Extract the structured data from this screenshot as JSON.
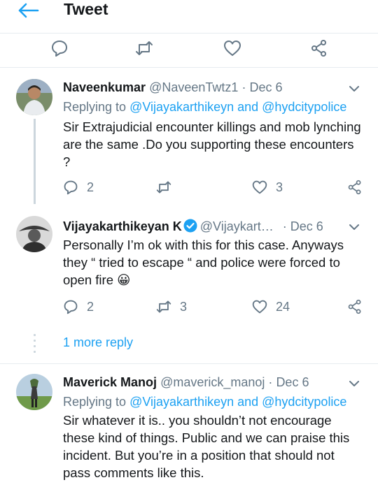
{
  "header": {
    "title": "Tweet"
  },
  "colors": {
    "accent": "#1da1f2",
    "muted": "#657786",
    "text": "#14171a",
    "border": "#e6ecf0"
  },
  "top_actions": [
    "reply-icon",
    "retweet-icon",
    "like-icon",
    "share-icon"
  ],
  "tweets": [
    {
      "name": "Naveenkumar",
      "handle": "@NaveenTwtz1",
      "dot": "·",
      "date": "Dec 6",
      "replying_prefix": "Replying to",
      "replying_users": "@Vijayakarthikeyn and @hydcitypolice",
      "text": "Sir Extrajudicial encounter killings and mob lynching are the same .Do you supporting these encounters ?",
      "replies": "2",
      "retweets": "",
      "likes": "3"
    },
    {
      "name": "Vijayakarthikeyan K",
      "handle": "@Vijaykart…",
      "dot": "·",
      "date": "Dec 6",
      "verified": true,
      "text": "Personally I’m ok with this for this case. Anyways they “ tried to escape “ and police were forced to open fire 😀",
      "replies": "2",
      "retweets": "3",
      "likes": "24"
    },
    {
      "name": "Maverick Manoj",
      "handle": "@maverick_manoj",
      "dot": "·",
      "date": "Dec 6",
      "replying_prefix": "Replying to",
      "replying_users": "@Vijayakarthikeyn and @hydcitypolice",
      "text": "Sir whatever it is.. you shouldn’t not encourage these kind of things. Public and we can praise this incident. But you’re in a position that should not pass comments like this."
    }
  ],
  "more_reply": "1 more reply"
}
